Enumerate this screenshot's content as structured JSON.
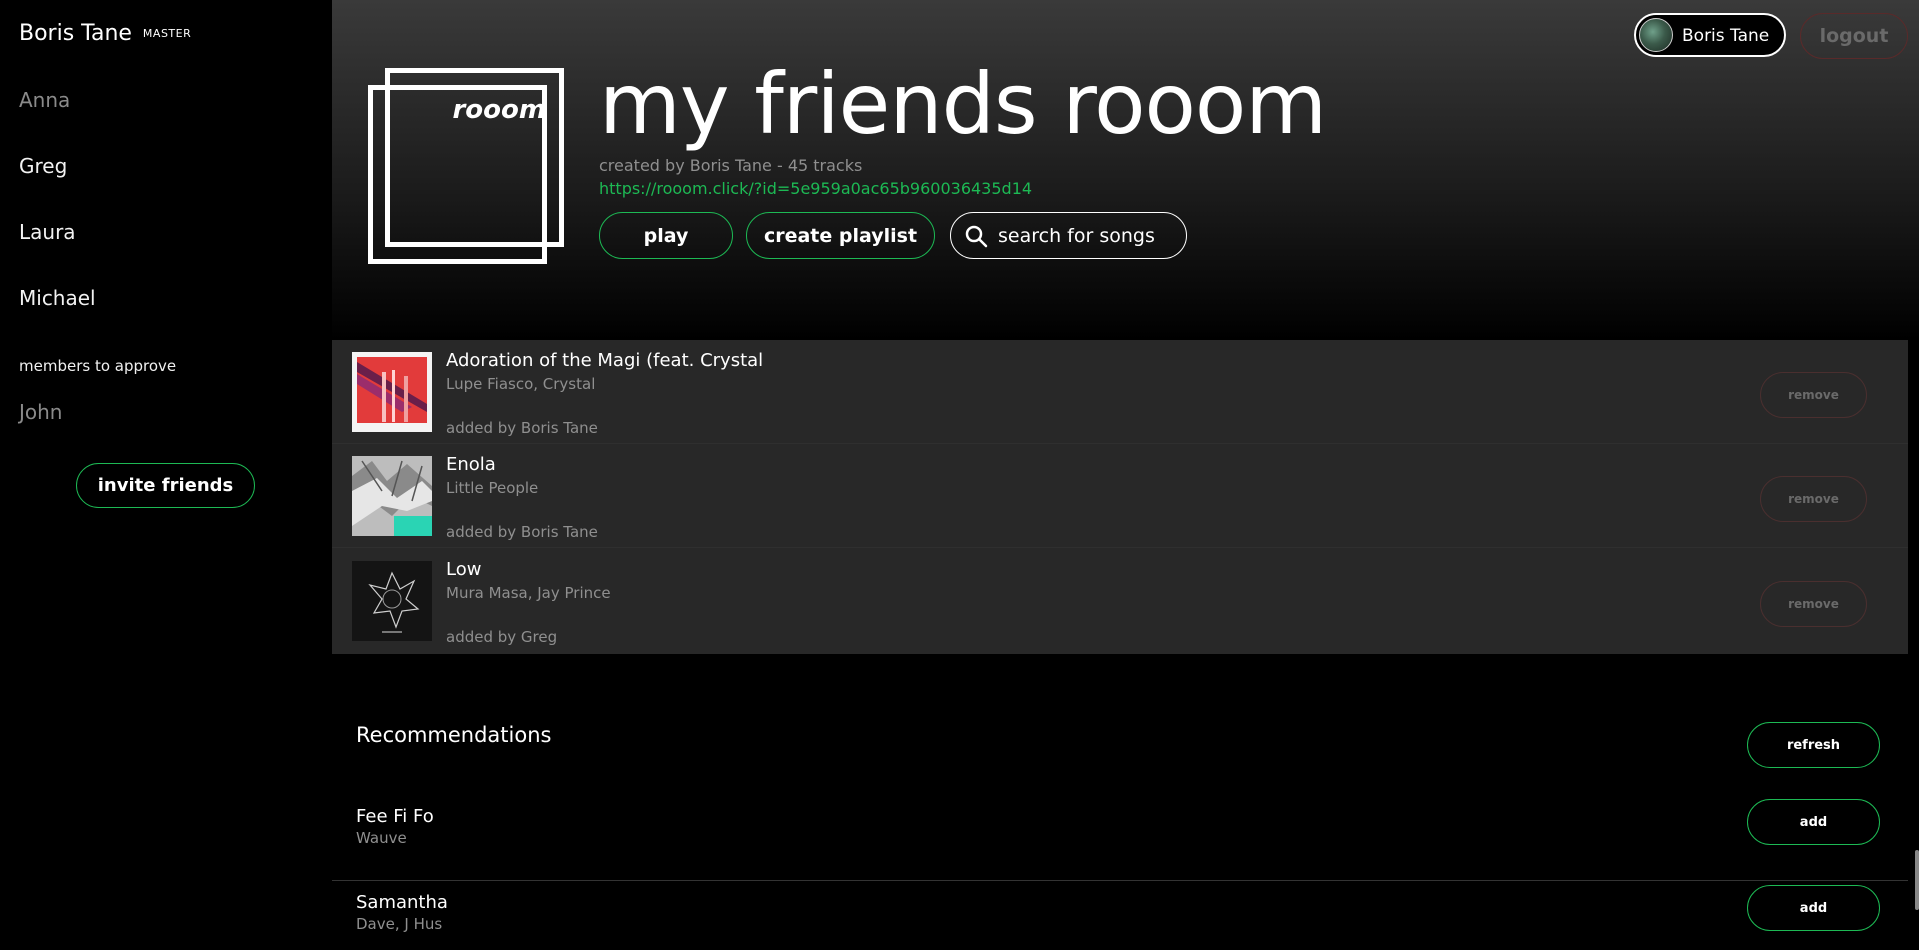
{
  "sidebar": {
    "owner_name": "Boris Tane",
    "owner_badge": "MASTER",
    "members": [
      "Anna",
      "Greg",
      "Laura",
      "Michael"
    ],
    "approve_label": "members to approve",
    "pending": [
      "John"
    ],
    "invite_label": "invite friends"
  },
  "header": {
    "logo_text": "rooom",
    "title": "my friends rooom",
    "meta": "created by Boris Tane - 45 tracks",
    "link": "https://rooom.click/?id=5e959a0ac65b960036435d14",
    "play_label": "play",
    "create_label": "create playlist",
    "search_label": "search for songs",
    "user_label": "Boris Tane",
    "logout_label": "logout"
  },
  "tracks": [
    {
      "title": "Adoration of the Magi (feat. Crystal",
      "artist": "Lupe Fiasco, Crystal",
      "added": "added by Boris Tane",
      "remove_label": "remove"
    },
    {
      "title": "Enola",
      "artist": "Little People",
      "added": "added by Boris Tane",
      "remove_label": "remove"
    },
    {
      "title": "Low",
      "artist": "Mura Masa, Jay Prince",
      "added": "added by Greg",
      "remove_label": "remove"
    }
  ],
  "recommendations": {
    "title": "Recommendations",
    "refresh_label": "refresh",
    "items": [
      {
        "title": "Fee Fi Fo",
        "artist": "Wauve",
        "add_label": "add"
      },
      {
        "title": "Samantha",
        "artist": "Dave, J Hus",
        "add_label": "add"
      }
    ]
  },
  "colors": {
    "accent": "#1db954",
    "background": "#000000",
    "panel": "#282828",
    "muted_text": "#8f8f8f"
  }
}
